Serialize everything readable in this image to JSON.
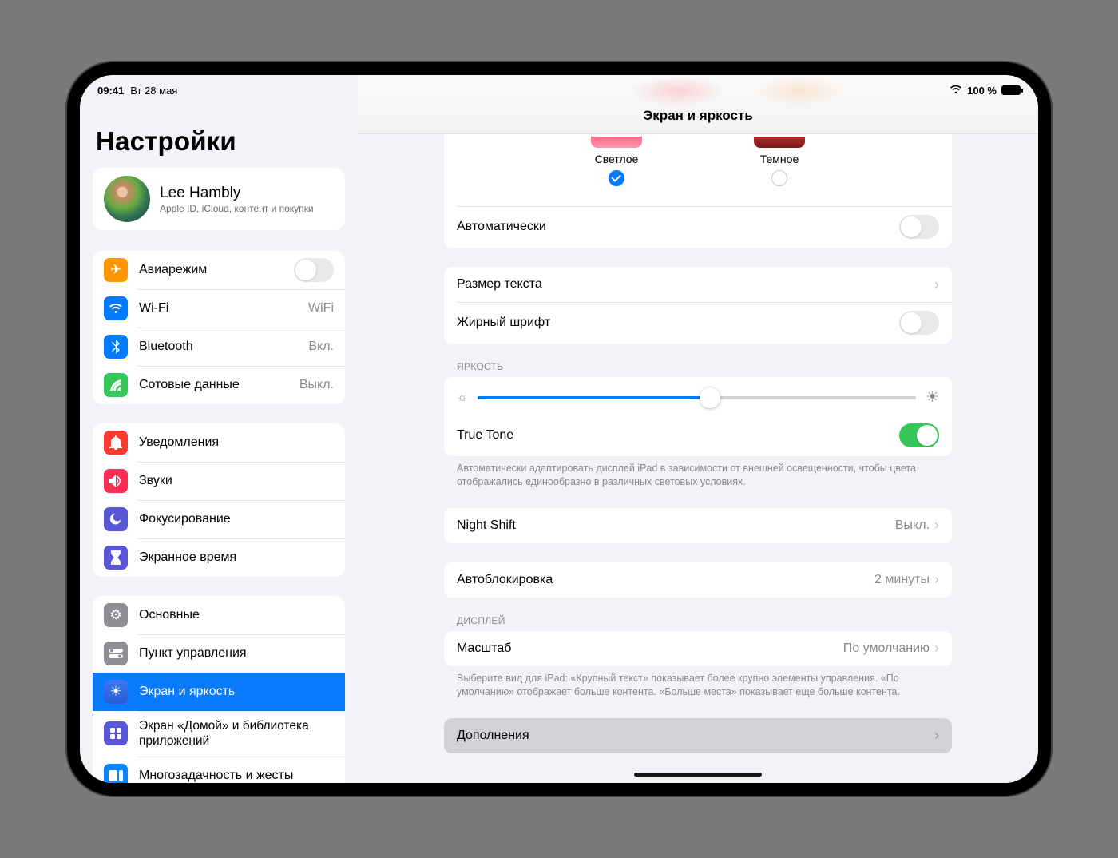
{
  "status": {
    "time": "09:41",
    "date": "Вт 28 мая",
    "battery_pct": "100 %"
  },
  "sidebar": {
    "title": "Настройки",
    "profile": {
      "name": "Lee Hambly",
      "sub": "Apple ID, iCloud, контент и покупки"
    },
    "g1": {
      "airplane": "Авиарежим",
      "wifi": "Wi-Fi",
      "wifi_val": "WiFi",
      "bt": "Bluetooth",
      "bt_val": "Вкл.",
      "cell": "Сотовые данные",
      "cell_val": "Выкл."
    },
    "g2": {
      "notif": "Уведомления",
      "sounds": "Звуки",
      "focus": "Фокусирование",
      "screentime": "Экранное время"
    },
    "g3": {
      "general": "Основные",
      "control": "Пункт управления",
      "display": "Экран и яркость",
      "home": "Экран «Домой» и библиотека приложений",
      "multi": "Многозадачность и жесты"
    }
  },
  "detail": {
    "title": "Экран и яркость",
    "appearance": {
      "light": "Светлое",
      "dark": "Темное",
      "auto": "Автоматически"
    },
    "text_size": "Размер текста",
    "bold": "Жирный шрифт",
    "brightness_header": "ЯРКОСТЬ",
    "true_tone": "True Tone",
    "true_tone_note": "Автоматически адаптировать дисплей iPad в зависимости от внешней освещенности, чтобы цвета отображались единообразно в различных световых условиях.",
    "night_shift": "Night Shift",
    "night_shift_val": "Выкл.",
    "autolock": "Автоблокировка",
    "autolock_val": "2 минуты",
    "display_header": "ДИСПЛЕЙ",
    "zoom": "Масштаб",
    "zoom_val": "По умолчанию",
    "zoom_note": "Выберите вид для iPad: «Крупный текст» показывает более крупно элементы управления. «По умолчанию» отображает больше контента. «Больше места» показывает еще больше контента.",
    "addons": "Дополнения"
  }
}
